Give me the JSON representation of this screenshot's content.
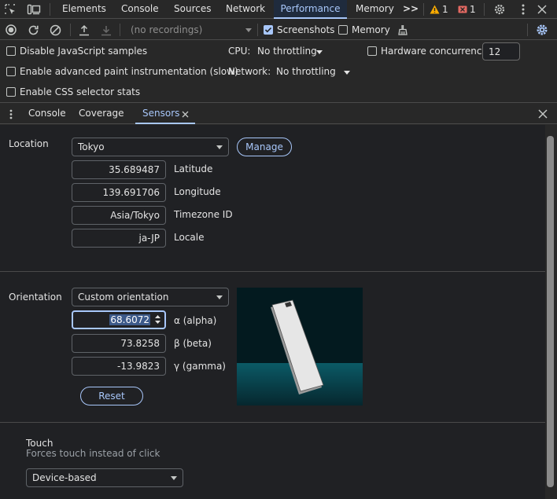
{
  "tabs": {
    "elements": "Elements",
    "console": "Console",
    "sources": "Sources",
    "network": "Network",
    "performance": "Performance",
    "memory": "Memory",
    "more": ">>",
    "warnings": "1",
    "errors": "1"
  },
  "toolbar": {
    "recordings": "(no recordings)",
    "screenshots": "Screenshots",
    "memory": "Memory"
  },
  "settings": {
    "disable_js_samples": "Disable JavaScript samples",
    "advanced_paint": "Enable advanced paint instrumentation (slow)",
    "css_selector_stats": "Enable CSS selector stats",
    "cpu_label": "CPU:",
    "cpu_value": "No throttling",
    "network_label": "Network:",
    "network_value": "No throttling",
    "hw_concurrency_label": "Hardware concurrency",
    "hw_concurrency_value": "12"
  },
  "drawer": {
    "console": "Console",
    "coverage": "Coverage",
    "sensors": "Sensors"
  },
  "location": {
    "label": "Location",
    "selected": "Tokyo",
    "manage": "Manage",
    "latitude_value": "35.689487",
    "latitude_label": "Latitude",
    "longitude_value": "139.691706",
    "longitude_label": "Longitude",
    "timezone_value": "Asia/Tokyo",
    "timezone_label": "Timezone ID",
    "locale_value": "ja-JP",
    "locale_label": "Locale"
  },
  "orientation": {
    "label": "Orientation",
    "selected": "Custom orientation",
    "alpha_value": "68.6072",
    "alpha_label": "α (alpha)",
    "beta_value": "73.8258",
    "beta_label": "β (beta)",
    "gamma_value": "-13.9823",
    "gamma_label": "γ (gamma)",
    "reset": "Reset"
  },
  "touch": {
    "title": "Touch",
    "description": "Forces touch instead of click",
    "selected": "Device-based"
  },
  "colors": {
    "accent": "#a8c7fa",
    "warning": "#f9ab00",
    "error": "#e46962"
  }
}
